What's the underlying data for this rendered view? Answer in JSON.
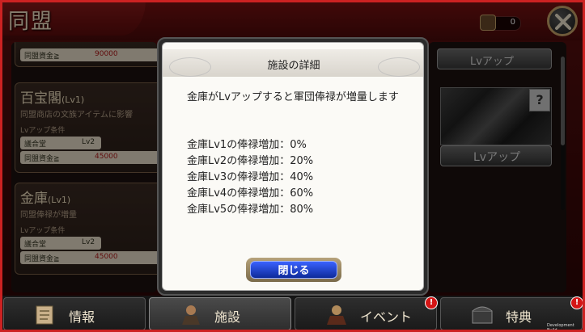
{
  "header": {
    "title": "同盟",
    "counter_value": "0"
  },
  "left_list": {
    "top_card": {
      "cost_label": "同盟資金≧",
      "cost_value": "90000"
    },
    "cards": [
      {
        "name": "百宝閣",
        "level": "(Lv1)",
        "desc": "同盟商店の文族アイテムに影響",
        "req_label": "Lvアップ条件",
        "req_building": "議合堂",
        "req_level": "Lv2",
        "cost_label": "同盟資金≧",
        "cost_value": "45000"
      },
      {
        "name": "金庫",
        "level": "(Lv1)",
        "desc": "同盟俸禄が増量",
        "req_label": "Lvアップ条件",
        "req_building": "議合堂",
        "req_level": "Lv2",
        "cost_label": "同盟資金≧",
        "cost_value": "45000"
      }
    ]
  },
  "right_panel": {
    "top_button": "Lvアップ",
    "lv_button": "Lvアップ",
    "unknown_mark": "?"
  },
  "dialog": {
    "title": "施設の詳細",
    "description": "金庫がLvアップすると軍団俸禄が増量します",
    "bonuses": [
      "金庫Lv1の俸禄増加：0%",
      "金庫Lv2の俸禄増加：20%",
      "金庫Lv3の俸禄増加：40%",
      "金庫Lv4の俸禄増加：60%",
      "金庫Lv5の俸禄増加：80%"
    ],
    "close_label": "閉じる"
  },
  "tabs": [
    {
      "label": "情報",
      "icon": "scroll-icon",
      "badge": ""
    },
    {
      "label": "施設",
      "icon": "general-icon",
      "badge": ""
    },
    {
      "label": "イベント",
      "icon": "warrior-icon",
      "badge": "!"
    },
    {
      "label": "特典",
      "icon": "chest-icon",
      "badge": "!"
    }
  ],
  "dev_build": "Development Build",
  "colors": {
    "accent_red": "#c22222",
    "button_blue": "#1a3fd0"
  }
}
